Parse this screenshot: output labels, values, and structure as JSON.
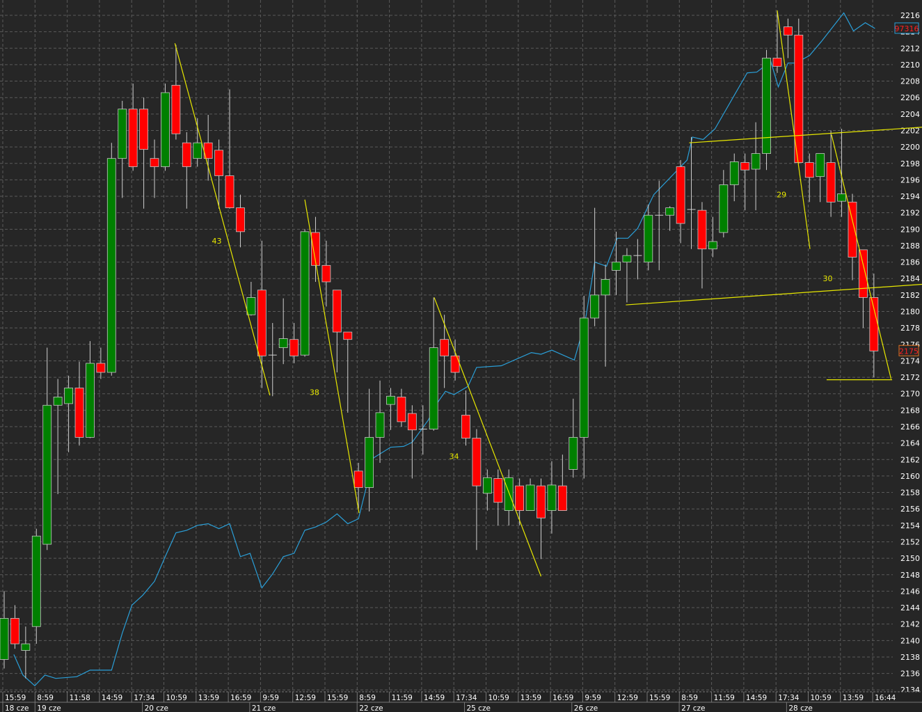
{
  "chart_data": {
    "type": "candlestick",
    "title": "",
    "ylim": [
      2134,
      2216
    ],
    "y_tick_step": 2,
    "grid": true,
    "colors": {
      "background": "#262626",
      "grid": "#5a5a5a",
      "up": "#008000",
      "down": "#ff0000",
      "wick": "#cfcfcf",
      "overlay_line": "#2a9fd8",
      "drawings": "#e8e800",
      "axis_text": "#ffffff"
    },
    "candles_ohlc": [
      [
        2137.7,
        2146,
        2136.6,
        2142.7
      ],
      [
        2142.7,
        2144.3,
        2139,
        2139.6
      ],
      [
        2138.8,
        2141.7,
        2135.4,
        2139.6
      ],
      [
        2141.7,
        2153.6,
        2139.6,
        2152.7
      ],
      [
        2151.7,
        2175.6,
        2151,
        2168.6
      ],
      [
        2168.6,
        2171.8,
        2157.8,
        2169.6
      ],
      [
        2168.8,
        2172.2,
        2162.9,
        2170.7
      ],
      [
        2170.7,
        2173.9,
        2163.7,
        2164.7
      ],
      [
        2164.7,
        2176.4,
        2164.6,
        2173.7
      ],
      [
        2173.7,
        2175.6,
        2171.8,
        2172.6
      ],
      [
        2172.6,
        2200.5,
        2172.2,
        2198.6
      ],
      [
        2198.6,
        2205.6,
        2193.8,
        2204.6
      ],
      [
        2204.6,
        2207.7,
        2197.1,
        2197.6
      ],
      [
        2204.6,
        2206,
        2192.5,
        2199.7
      ],
      [
        2198.6,
        2200.9,
        2193.8,
        2197.6
      ],
      [
        2197.6,
        2207.7,
        2197.1,
        2206.6
      ],
      [
        2207.5,
        2212.4,
        2200.9,
        2201.6
      ],
      [
        2200.5,
        2201.8,
        2192.5,
        2197.6
      ],
      [
        2198.6,
        2203.5,
        2197.6,
        2200.5
      ],
      [
        2200.5,
        2203.9,
        2195.9,
        2198.6
      ],
      [
        2199.6,
        2200.9,
        2192.5,
        2196.5
      ],
      [
        2196.5,
        2207,
        2192.5,
        2192.6
      ],
      [
        2192.6,
        2194.2,
        2187.8,
        2189.7
      ],
      [
        2179.6,
        2183.6,
        2179.5,
        2181.7
      ],
      [
        2182.6,
        2188.6,
        2170.7,
        2174.6
      ],
      [
        2174.7,
        2178.6,
        2169.7,
        2174.7
      ],
      [
        2175.6,
        2181.6,
        2173.6,
        2176.7
      ],
      [
        2176.6,
        2178.6,
        2173.7,
        2174.6
      ],
      [
        2174.7,
        2190,
        2174.5,
        2189.7
      ],
      [
        2189.6,
        2191.5,
        2183.6,
        2185.6
      ],
      [
        2185.6,
        2188.6,
        2180.6,
        2183.6
      ],
      [
        2182.6,
        2182.6,
        2172.6,
        2177.5
      ],
      [
        2177.5,
        2177.5,
        2167.7,
        2176.6
      ],
      [
        2160.6,
        2161.6,
        2156,
        2158.6
      ],
      [
        2158.6,
        2170.6,
        2155.7,
        2164.7
      ],
      [
        2164.7,
        2171.6,
        2161.6,
        2167.7
      ],
      [
        2168.7,
        2170.7,
        2165.6,
        2169.7
      ],
      [
        2169.6,
        2170.6,
        2166,
        2166.6
      ],
      [
        2167.6,
        2168.6,
        2159.7,
        2165.6
      ],
      [
        2165.7,
        2168.6,
        2162.6,
        2165.7
      ],
      [
        2165.7,
        2181.7,
        2165.5,
        2175.6
      ],
      [
        2176.6,
        2179.6,
        2170.7,
        2174.6
      ],
      [
        2174.6,
        2176.6,
        2171.6,
        2172.6
      ],
      [
        2167.4,
        2170.4,
        2163.7,
        2164.6
      ],
      [
        2164.6,
        2165.7,
        2151,
        2158.8
      ],
      [
        2157.9,
        2160.8,
        2155.8,
        2159.8
      ],
      [
        2159.7,
        2160.8,
        2154,
        2156.8
      ],
      [
        2155.8,
        2160.8,
        2154,
        2159.8
      ],
      [
        2158.8,
        2159.7,
        2154,
        2155.8
      ],
      [
        2155.8,
        2159.7,
        2155.8,
        2158.9
      ],
      [
        2158.8,
        2159.7,
        2149.9,
        2154.9
      ],
      [
        2155.8,
        2161.8,
        2153,
        2158.9
      ],
      [
        2158.8,
        2162.6,
        2155.8,
        2155.8
      ],
      [
        2160.8,
        2169.4,
        2159.8,
        2164.7
      ],
      [
        2164.7,
        2181.9,
        2159.7,
        2179.2
      ],
      [
        2179.2,
        2192.6,
        2178.2,
        2182
      ],
      [
        2182,
        2185.7,
        2173.3,
        2183.9
      ],
      [
        2185,
        2189.7,
        2182,
        2186
      ],
      [
        2186,
        2187.7,
        2181.1,
        2186.8
      ],
      [
        2186.8,
        2188.8,
        2183.9,
        2186.8
      ],
      [
        2186,
        2193,
        2185,
        2191.7
      ],
      [
        2191.7,
        2195.9,
        2185,
        2191.7
      ],
      [
        2191.7,
        2192.8,
        2189.8,
        2192.6
      ],
      [
        2197.6,
        2198.4,
        2188.3,
        2190.7
      ],
      [
        2192.4,
        2201.2,
        2187.6,
        2192.4
      ],
      [
        2192.3,
        2193.3,
        2182.8,
        2187.6
      ],
      [
        2187.6,
        2191.5,
        2186.6,
        2188.5
      ],
      [
        2189.6,
        2197.2,
        2189,
        2195.4
      ],
      [
        2195.4,
        2199.2,
        2193.4,
        2198.2
      ],
      [
        2198.1,
        2199.2,
        2192.3,
        2197.2
      ],
      [
        2197.3,
        2203,
        2192.3,
        2199.2
      ],
      [
        2199.2,
        2211.8,
        2197.2,
        2210.8
      ],
      [
        2210.8,
        2216.6,
        2209,
        2209.8
      ],
      [
        2214.6,
        2215.6,
        2210.8,
        2213.6
      ],
      [
        2213.6,
        2215.6,
        2198,
        2198.1
      ],
      [
        2198.1,
        2199.2,
        2193.3,
        2196.3
      ],
      [
        2196.4,
        2199.2,
        2193.3,
        2199.2
      ],
      [
        2198.1,
        2202,
        2191.5,
        2193.3
      ],
      [
        2193.4,
        2202.2,
        2191.5,
        2194.3
      ],
      [
        2193.3,
        2194.3,
        2183.8,
        2186.6
      ],
      [
        2187.5,
        2187.5,
        2178,
        2181.7
      ],
      [
        2181.7,
        2184.6,
        2172,
        2175.2
      ]
    ],
    "overlay_series": {
      "name": "comparison line",
      "last_value_tag": "97316",
      "points": [
        [
          0.9,
          2138.3
        ],
        [
          1.75,
          2135.8
        ],
        [
          2.85,
          2134.5
        ],
        [
          3.8,
          2135.8
        ],
        [
          4.8,
          2135.4
        ],
        [
          6.75,
          2135.6
        ],
        [
          8,
          2136.4
        ],
        [
          10,
          2136.4
        ],
        [
          11,
          2140.9
        ],
        [
          11.9,
          2144.3
        ],
        [
          12.9,
          2145.5
        ],
        [
          14,
          2147.2
        ],
        [
          15,
          2150.2
        ],
        [
          16,
          2153.1
        ],
        [
          17,
          2153.4
        ],
        [
          18,
          2154
        ],
        [
          19,
          2154.2
        ],
        [
          20,
          2153.6
        ],
        [
          21,
          2154.2
        ],
        [
          22,
          2150.2
        ],
        [
          22.9,
          2150.6
        ],
        [
          24,
          2146.4
        ],
        [
          25,
          2148.1
        ],
        [
          26,
          2150.2
        ],
        [
          27,
          2150.6
        ],
        [
          28,
          2153.4
        ],
        [
          29,
          2153.8
        ],
        [
          30,
          2154.4
        ],
        [
          31,
          2155.4
        ],
        [
          32,
          2154.2
        ],
        [
          33,
          2154.8
        ],
        [
          34.4,
          2162.2
        ],
        [
          36,
          2163.5
        ],
        [
          37.2,
          2163.6
        ],
        [
          38,
          2164.1
        ],
        [
          39.5,
          2166.8
        ],
        [
          40.4,
          2169
        ],
        [
          41.1,
          2170.3
        ],
        [
          41.9,
          2169.9
        ],
        [
          43.2,
          2170.9
        ],
        [
          44,
          2173.2
        ],
        [
          46.3,
          2173.4
        ],
        [
          49.1,
          2175
        ],
        [
          50,
          2174.8
        ],
        [
          51,
          2175.3
        ],
        [
          53.1,
          2174.1
        ],
        [
          53.6,
          2176.4
        ],
        [
          54.2,
          2179.5
        ],
        [
          55,
          2186
        ],
        [
          56.1,
          2185.5
        ],
        [
          57.1,
          2188.9
        ],
        [
          58.1,
          2188.9
        ],
        [
          59,
          2190.1
        ],
        [
          60.5,
          2194.2
        ],
        [
          63.6,
          2198.4
        ],
        [
          64.1,
          2201.2
        ],
        [
          65.1,
          2200.9
        ],
        [
          66.2,
          2202.2
        ],
        [
          69.2,
          2209
        ],
        [
          70.1,
          2209.1
        ],
        [
          71.4,
          2210.4
        ],
        [
          72.1,
          2207.3
        ],
        [
          73,
          2210.2
        ],
        [
          73.7,
          2210.2
        ],
        [
          75,
          2211.1
        ],
        [
          76.1,
          2212.8
        ],
        [
          78.2,
          2216.3
        ],
        [
          79.1,
          2214.1
        ],
        [
          80.2,
          2215.1
        ],
        [
          81.1,
          2214.4
        ]
      ]
    },
    "last_price_tag": "2175",
    "drawings": [
      {
        "from": [
          15.9,
          2212.6
        ],
        "to": [
          24.75,
          2169.8
        ]
      },
      {
        "from": [
          28.0,
          2193.6
        ],
        "to": [
          33.05,
          2155.5
        ]
      },
      {
        "from": [
          40.05,
          2181.7
        ],
        "to": [
          50.0,
          2147.8
        ]
      },
      {
        "from": [
          72.0,
          2216.6
        ],
        "to": [
          75.05,
          2187.6
        ]
      },
      {
        "from": [
          77.05,
          2201.5
        ],
        "to": [
          82.6,
          2171.8
        ]
      },
      {
        "from": [
          63.8,
          2200.5
        ],
        "to": [
          85.5,
          2202.4
        ]
      },
      {
        "from": [
          57.9,
          2180.8
        ],
        "to": [
          85.5,
          2183.3
        ]
      },
      {
        "from": [
          76.6,
          2171.7
        ],
        "to": [
          82.7,
          2171.7
        ]
      }
    ],
    "annotations": [
      {
        "text": "43",
        "at": [
          19.8,
          2188.6
        ]
      },
      {
        "text": "38",
        "at": [
          28.9,
          2170.2
        ]
      },
      {
        "text": "34",
        "at": [
          41.9,
          2162.4
        ]
      },
      {
        "text": "29",
        "at": [
          72.4,
          2194.2
        ]
      },
      {
        "text": "30",
        "at": [
          76.7,
          2184.0
        ]
      }
    ],
    "x_time_labels": [
      "15:59",
      "8:59",
      "11:58",
      "14:59",
      "17:34",
      "10:59",
      "13:59",
      "16:59",
      "9:59",
      "12:59",
      "15:59",
      "8:59",
      "11:59",
      "14:59",
      "17:34",
      "10:59",
      "13:59",
      "16:59",
      "9:59",
      "12:59",
      "15:59",
      "8:59",
      "11:59",
      "14:59",
      "17:34",
      "10:59",
      "13:59",
      "16:44"
    ],
    "x_day_labels": [
      {
        "text": "18 cze",
        "start_index": 0
      },
      {
        "text": "19 cze",
        "start_index": 3
      },
      {
        "text": "20 cze",
        "start_index": 13
      },
      {
        "text": "21 cze",
        "start_index": 23
      },
      {
        "text": "22 cze",
        "start_index": 33
      },
      {
        "text": "25 cze",
        "start_index": 43
      },
      {
        "text": "26 cze",
        "start_index": 53
      },
      {
        "text": "27 cze",
        "start_index": 63
      },
      {
        "text": "28 cze",
        "start_index": 73
      }
    ]
  }
}
